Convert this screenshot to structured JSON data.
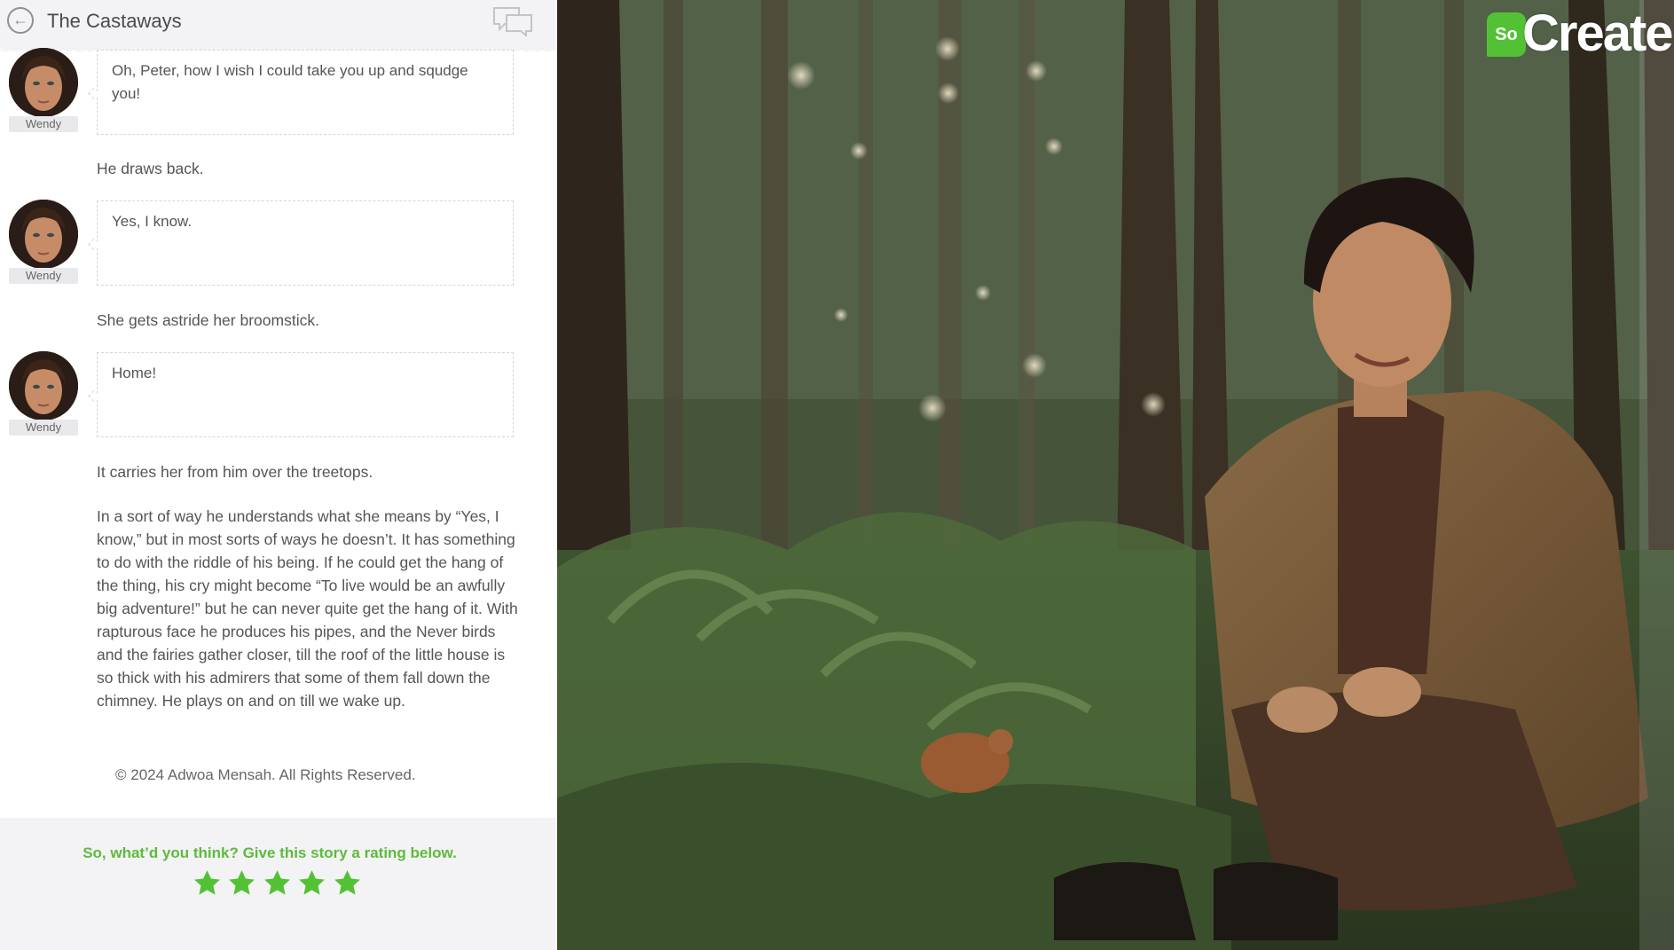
{
  "header": {
    "back_icon": "back-arrow-icon",
    "title": "The Castaways",
    "comments_icon": "comments-icon"
  },
  "messages": [
    {
      "speaker": "Wendy",
      "text": "Oh, Peter, how I wish I could take you up and squdge you!"
    },
    {
      "speaker": "Wendy",
      "text": "Yes, I know."
    },
    {
      "speaker": "Wendy",
      "text": "Home!"
    }
  ],
  "narration": [
    "He draws back.",
    "She gets astride her broomstick.",
    "It carries her from him over the treetops.",
    "In a sort of way he understands what she means by “Yes, I know,” but in most sorts of ways he doesn’t. It has something to do with the riddle of his being. If he could get the hang of the thing, his cry might become “To live would be an awfully big adventure!” but he can never quite get the hang of it. With rapturous face he produces his pipes, and the Never birds and the fairies gather closer, till the roof of the little house is so thick with his admirers that some of them fall down the chimney. He plays on and on till we wake up."
  ],
  "footer": {
    "copyright": "© 2024 Adwoa Mensah. All Rights Reserved."
  },
  "rating": {
    "prompt": "So, what’d you think? Give this story a rating below.",
    "stars": 5,
    "star_color": "#52c234"
  },
  "brand": {
    "badge": "So",
    "wordmark": "Create",
    "color": "#52c234"
  }
}
